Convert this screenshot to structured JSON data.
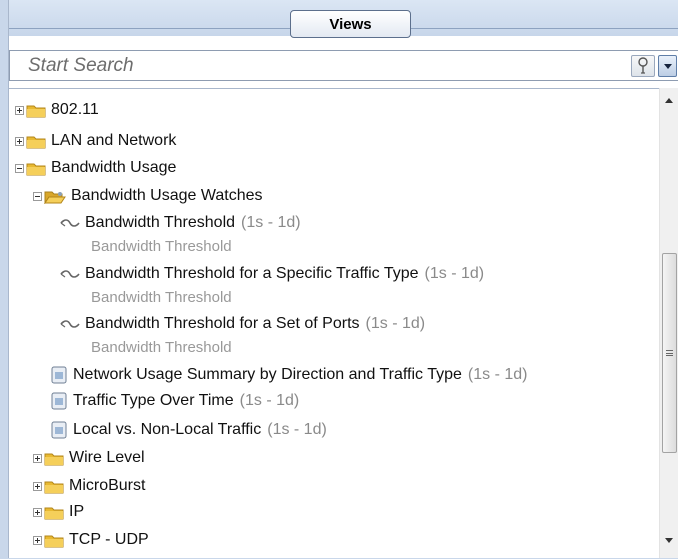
{
  "header": {
    "title": "Views"
  },
  "search": {
    "placeholder": "Start Search"
  },
  "tree": {
    "items": [
      {
        "label": "802.11"
      },
      {
        "label": "LAN and Network"
      },
      {
        "label": "Bandwidth Usage"
      },
      {
        "label": "Bandwidth Usage Watches"
      },
      {
        "label": "Bandwidth Threshold",
        "meta": "(1s - 1d)",
        "subtitle": "Bandwidth Threshold"
      },
      {
        "label": "Bandwidth Threshold for a Specific Traffic Type",
        "meta": "(1s - 1d)",
        "subtitle": "Bandwidth Threshold"
      },
      {
        "label": "Bandwidth Threshold for a Set of Ports",
        "meta": "(1s - 1d)",
        "subtitle": "Bandwidth Threshold"
      },
      {
        "label": "Network Usage Summary by Direction and Traffic Type",
        "meta": "(1s - 1d)"
      },
      {
        "label": "Traffic Type Over Time",
        "meta": "(1s - 1d)"
      },
      {
        "label": "Local vs. Non-Local Traffic",
        "meta": "(1s - 1d)"
      },
      {
        "label": "Wire Level"
      },
      {
        "label": "MicroBurst"
      },
      {
        "label": "IP"
      },
      {
        "label": "TCP - UDP"
      }
    ]
  },
  "icons": {
    "folder": "folder-icon",
    "open_folder": "open-folder-icon",
    "watch": "watch-icon",
    "view": "document-view-icon",
    "search": "search-icon",
    "dropdown": "chevron-down-icon"
  },
  "colors": {
    "header_band": "#c7d6ea",
    "meta_text": "#8a8a8a",
    "folder": "#e8b931"
  }
}
